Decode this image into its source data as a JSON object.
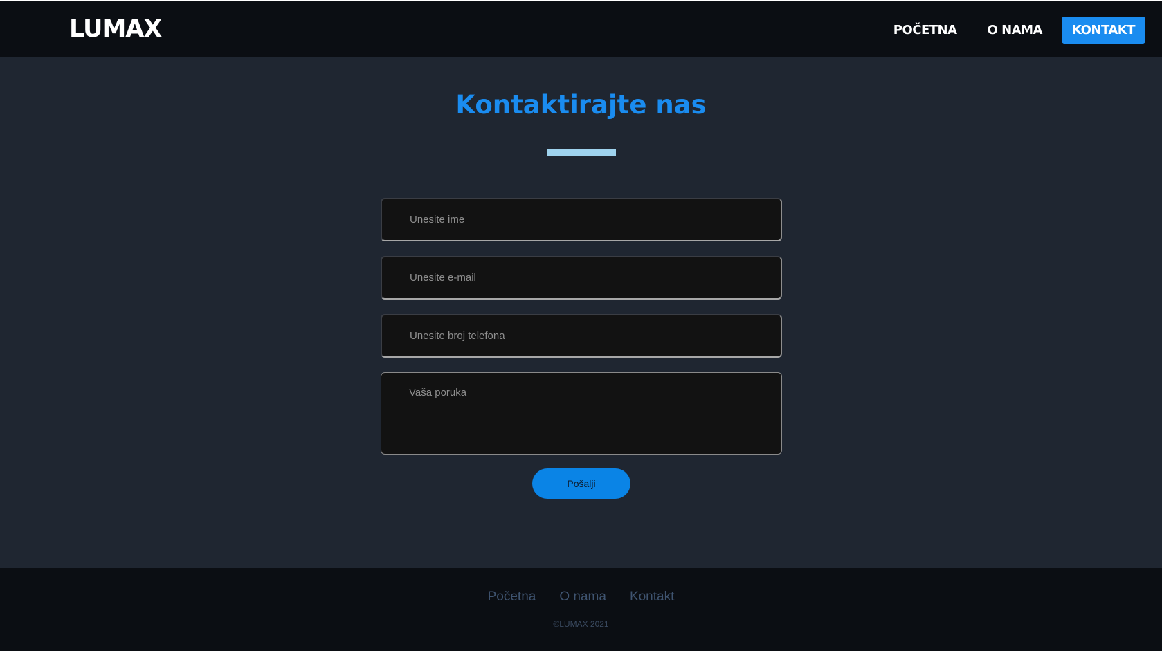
{
  "header": {
    "logo": "LUMAX",
    "nav": [
      {
        "label": "POČETNA",
        "active": false
      },
      {
        "label": "O NAMA",
        "active": false
      },
      {
        "label": "KONTAKT",
        "active": true
      }
    ]
  },
  "main": {
    "title": "Kontaktirajte nas",
    "form": {
      "name_placeholder": "Unesite ime",
      "email_placeholder": "Unesite e-mail",
      "phone_placeholder": "Unesite broj telefona",
      "message_placeholder": "Vaša poruka",
      "submit_label": "Pošalji"
    }
  },
  "footer": {
    "links": [
      "Početna",
      "O nama",
      "Kontakt"
    ],
    "copyright": "©LUMAX 2021"
  },
  "colors": {
    "accent": "#1a8cf0",
    "background": "#1f2631",
    "header_bg": "#0b0e13",
    "divider": "#9fd3ee"
  }
}
